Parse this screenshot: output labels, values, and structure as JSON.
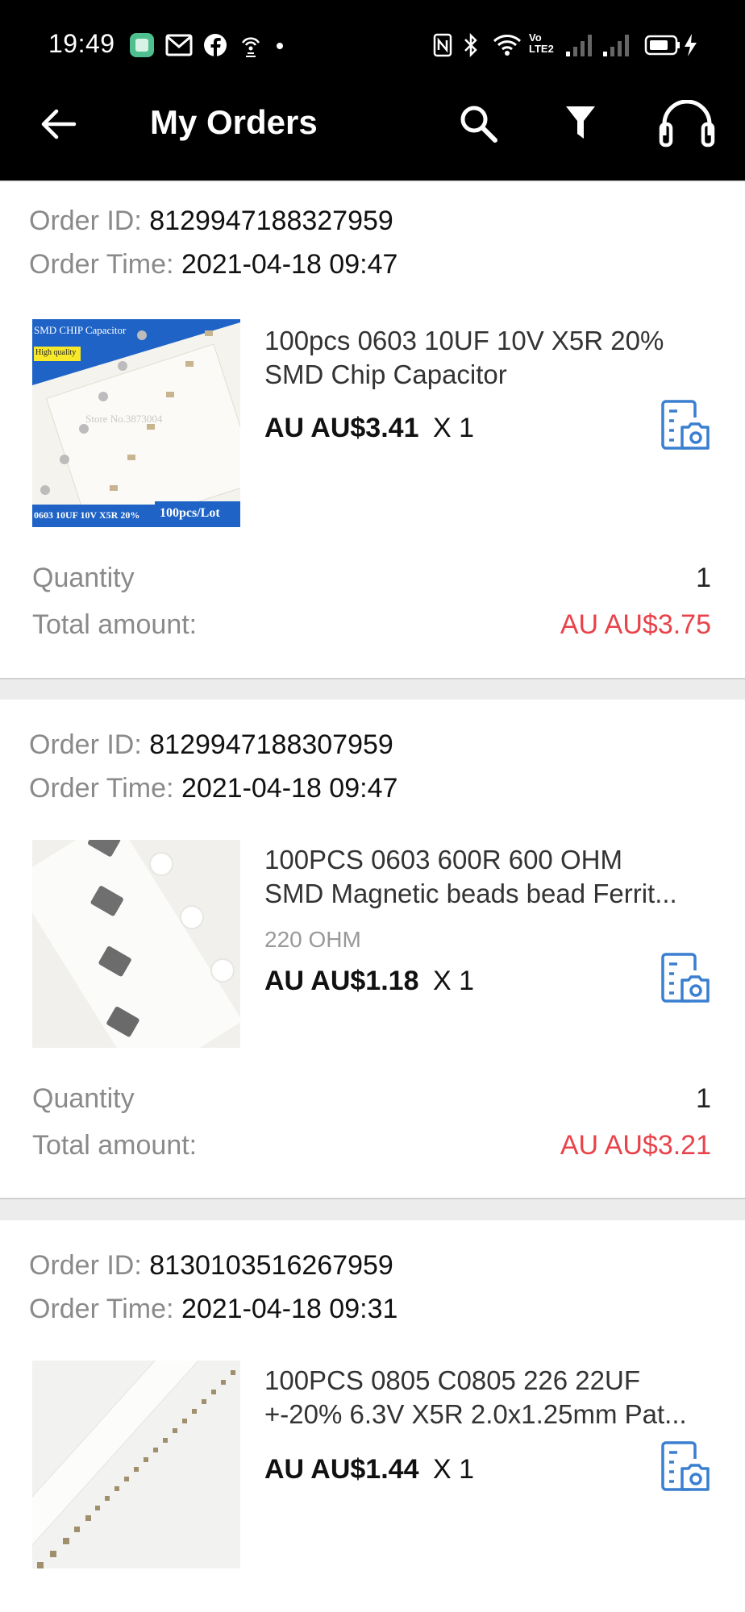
{
  "status_bar": {
    "time": "19:49",
    "left_icons": [
      "app-icon",
      "gmail-icon",
      "facebook-icon",
      "hotspot-icon",
      "dot-icon"
    ],
    "right_icons": [
      "nfc-icon",
      "bluetooth-icon",
      "wifi-icon",
      "volte-icon",
      "signal-icon",
      "signal-icon",
      "battery-charging-icon"
    ],
    "volte_label": "Vo LTE2"
  },
  "app_bar": {
    "title": "My Orders",
    "icons": [
      "back-arrow-icon",
      "search-icon",
      "filter-icon",
      "headset-icon"
    ]
  },
  "labels": {
    "order_id": "Order ID:",
    "order_time": "Order Time:",
    "quantity": "Quantity",
    "total": "Total amount:",
    "qty_prefix": "X"
  },
  "orders": [
    {
      "id": "8129947188327959",
      "time": "2021-04-18 09:47",
      "title_line1": "100pcs 0603 10UF 10V X5R 20%",
      "title_line2": "SMD Chip Capacitor",
      "variant": "",
      "price": "AU AU$3.41",
      "qty": "1",
      "quantity": "1",
      "total": "AU AU$3.75",
      "image_text": {
        "banner": "SMD CHIP Capacitor",
        "badge": "High quality",
        "watermark": "Store No.3873004",
        "footer_left": "0603 10UF 10V X5R 20%",
        "footer_right": "100pcs/Lot"
      }
    },
    {
      "id": "8129947188307959",
      "time": "2021-04-18 09:47",
      "title_line1": "100PCS 0603 600R 600 OHM",
      "title_line2": "SMD Magnetic beads bead Ferrit...",
      "variant": "220 OHM",
      "price": "AU AU$1.18",
      "qty": "1",
      "quantity": "1",
      "total": "AU AU$3.21"
    },
    {
      "id": "8130103516267959",
      "time": "2021-04-18 09:31",
      "title_line1": "100PCS 0805 C0805 226 22UF",
      "title_line2": "+-20% 6.3V X5R 2.0x1.25mm Pat...",
      "variant": "",
      "price": "AU AU$1.44",
      "qty": "1"
    }
  ],
  "colors": {
    "bar_background": "#000000",
    "total_red": "#e8434a",
    "icon_blue": "#3a7fd0",
    "page_background": "#ececec"
  }
}
